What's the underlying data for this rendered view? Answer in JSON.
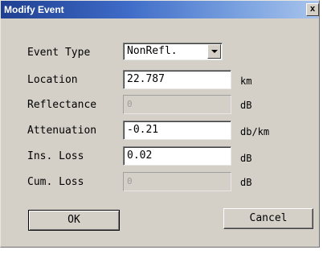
{
  "window": {
    "title": "Modify Event",
    "close_label": "x"
  },
  "form": {
    "event_type": {
      "label": "Event Type",
      "value": "NonRefl."
    },
    "location": {
      "label": "Location",
      "value": "22.787",
      "unit": "km"
    },
    "reflectance": {
      "label": "Reflectance",
      "value": "0",
      "unit": "dB"
    },
    "attenuation": {
      "label": "Attenuation",
      "value": "-0.21",
      "unit": "db/km"
    },
    "ins_loss": {
      "label": "Ins. Loss",
      "value": "0.02",
      "unit": "dB"
    },
    "cum_loss": {
      "label": "Cum. Loss",
      "value": "0",
      "unit": "dB"
    }
  },
  "buttons": {
    "ok": "OK",
    "cancel": "Cancel"
  }
}
